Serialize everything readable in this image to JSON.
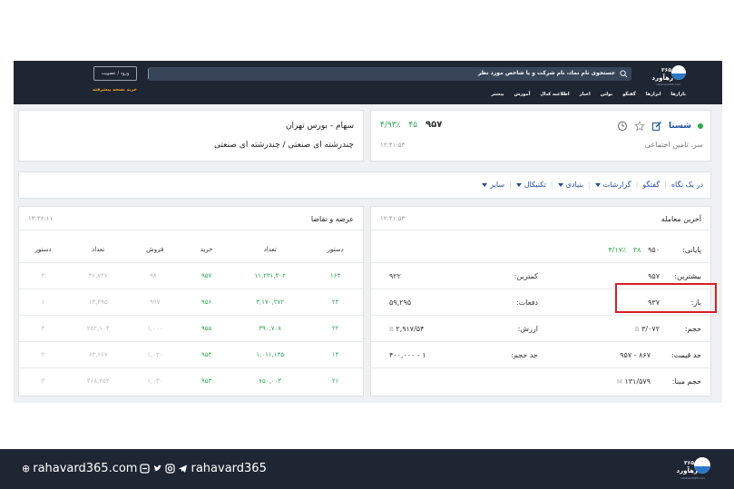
{
  "header": {
    "logo": {
      "number": "۳۶۵",
      "name": "رهآورد",
      "tagline": "rahavard365.com"
    },
    "search_placeholder": "جستجوی نام نماد، نام شرکت و یا شاخص مورد نظر",
    "login_label": "ورود / عضویت",
    "buy_label": "خرید نسخه پیشرفته",
    "nav": [
      "بازارها",
      "ابزارها",
      "گفتگو",
      "بولتن",
      "اخبار",
      "اطلاعیه کدال",
      "آموزش",
      "بیشتر"
    ]
  },
  "symbol": {
    "name": "شستا",
    "company": "سر. تامین اجتماعی",
    "last_price": "۹۵۷",
    "change": "۴۵",
    "change_pct": "۴/۹۳٪",
    "time": "۱۲:۴۱:۵۳",
    "status_color": "#2fa84f"
  },
  "market_info": {
    "market": "سهام - بورس تهران",
    "sector": "چندرشته ای صنعتی / چندرشته ای صنعتی"
  },
  "tabs": [
    {
      "label": "در یک نگاه",
      "dropdown": false
    },
    {
      "label": "گفتگو",
      "dropdown": false
    },
    {
      "label": "گزارشات",
      "dropdown": true
    },
    {
      "label": "بنیادی",
      "dropdown": true
    },
    {
      "label": "تکنیکال",
      "dropdown": true
    },
    {
      "label": "سایر",
      "dropdown": true
    }
  ],
  "orderbook": {
    "title": "عرضه و تقاضا",
    "time": "۱۳:۳۶:۱۱",
    "headers": [
      "دستور",
      "تعداد",
      "خرید",
      "فروش",
      "تعداد",
      "دستور"
    ],
    "rows": [
      [
        "۱۶۳",
        "۱۱,۲۳۱,۴۰۲",
        "۹۵۷",
        "۹۸۰",
        "۳۶,۷۲۷",
        "۳"
      ],
      [
        "۲۳",
        "۳,۱۷۰,۲۷۲",
        "۹۵۶",
        "۹۹۷",
        "۱۳,۳۹۵",
        "۱"
      ],
      [
        "۲۲",
        "۳۹۰,۷۰۸",
        "۹۵۵",
        "۱,۰۰۰",
        "۲۸۲,۱۰۴",
        "۴"
      ],
      [
        "۱۴",
        "۱,۰۱۱,۱۳۵",
        "۹۵۴",
        "۱,۰۲۰",
        "۶۳,۶۶۷",
        "۲"
      ],
      [
        "۲۱",
        "۷۵۰,۰۰۳",
        "۹۵۳",
        "۱,۰۳۰",
        "۴۶۸,۴۵۴",
        "۲"
      ]
    ]
  },
  "trade": {
    "title": "آخرین معامله",
    "time": "۱۲:۴۱:۵۳",
    "closing": {
      "label": "پایانی:",
      "price": "۹۵۰",
      "change": "۳۸",
      "pct": "۴/۱۷٪"
    },
    "high": {
      "label": "بیشترین:",
      "value": "۹۵۷"
    },
    "low": {
      "label": "کمترین:",
      "value": "۹۲۲"
    },
    "open": {
      "label": "باز:",
      "value": "۹۳۷"
    },
    "count": {
      "label": "دفعات:",
      "value": "۵۹,۲۹۵"
    },
    "volume": {
      "label": "حجم:",
      "value": "۳/۰۷۲",
      "unit": "B"
    },
    "value_traded": {
      "label": "ارزش:",
      "value": "۲,۹۱۷/۵۴",
      "unit": "B"
    },
    "price_limit": {
      "label": "حد قیمت:",
      "value": "۸۶۷ - ۹۵۷"
    },
    "volume_limit": {
      "label": "حد حجم:",
      "value": "۱ - ۴۰۰,۰۰۰"
    },
    "base_volume": {
      "label": "حجم مبنا:",
      "value": "۱۳۱/۵۷۹",
      "unit": "M"
    },
    "highlight_color": "#d51f26"
  },
  "footer": {
    "site": "rahavard365.com",
    "handle": "rahavard365",
    "logo": {
      "number": "۳۶۵",
      "name": "رهآورد",
      "tagline": "rahavard365.com"
    }
  }
}
